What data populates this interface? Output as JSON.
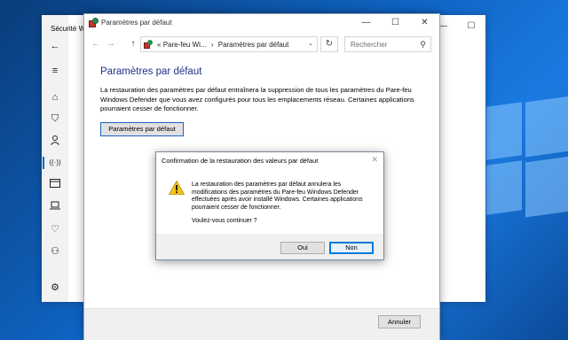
{
  "desktop": {
    "accent": "#0f63c2"
  },
  "security_window": {
    "title": "Sécurité Wi",
    "nav_icons": [
      "back-arrow-icon",
      "hamburger-icon",
      "home-icon",
      "shield-icon",
      "person-icon",
      "wifi-antenna-icon",
      "browser-icon",
      "laptop-icon",
      "heart-icon",
      "family-icon",
      "gear-icon"
    ],
    "controls": {
      "minimize": "—",
      "maximize": "☐"
    }
  },
  "main_window": {
    "title": "Paramètres par défaut",
    "controls": {
      "minimize": "—",
      "maximize": "☐",
      "close": "✕"
    },
    "nav": {
      "back": "←",
      "forward": "→",
      "up": "↑"
    },
    "address": {
      "prefix": "«",
      "crumb1": "Pare-feu Wi...",
      "separator": "›",
      "crumb2": "Paramètres par défaut",
      "dropdown": "⌄"
    },
    "refresh": "↻",
    "search": {
      "placeholder": "Rechercher"
    },
    "page_title": "Paramètres par défaut",
    "description": "La restauration des paramètres par défaut entraînera la suppression de tous les paramètres du Pare-feu Windows Defender que vous avez configurés pour tous les emplacements réseau. Certaines applications pourraient cesser de fonctionner.",
    "default_button": "Paramètres par défaut",
    "cancel_button": "Annuler"
  },
  "dialog": {
    "title": "Confirmation de la restauration des valeurs par défaut",
    "close": "✕",
    "message": "La restauration des paramètres par défaut annulera les modifications des paramètres du Pare-feu Windows Defender effectuées après avoir installé Windows. Certaines applications pourraient cesser de fonctionner.",
    "question": "Voulez-vous continuer ?",
    "yes_button": "Oui",
    "no_button": "Non",
    "warning_color": "#f7c31b"
  }
}
